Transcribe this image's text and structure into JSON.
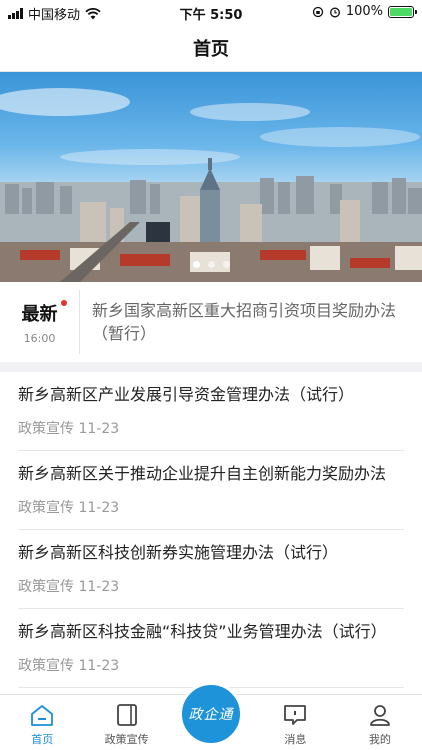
{
  "status_bar": {
    "carrier": "中国移动",
    "time": "下午 5:50",
    "battery": "100%"
  },
  "nav": {
    "title": "首页"
  },
  "latest": {
    "label": "最新",
    "time": "16:00",
    "text": "新乡国家高新区重大招商引资项目奖励办法（暂行）"
  },
  "news": [
    {
      "title": "新乡高新区产业发展引导资金管理办法（试行）",
      "meta": "政策宣传 11-23"
    },
    {
      "title": "新乡高新区关于推动企业提升自主创新能力奖励办法",
      "meta": "政策宣传 11-23"
    },
    {
      "title": "新乡高新区科技创新券实施管理办法（试行）",
      "meta": "政策宣传 11-23"
    },
    {
      "title": "新乡高新区科技金融“科技贷”业务管理办法（试行）",
      "meta": "政策宣传 11-23"
    }
  ],
  "tabs": {
    "home": "首页",
    "policy": "政策宣传",
    "center": "政企通",
    "messages": "消息",
    "mine": "我的"
  },
  "colors": {
    "accent": "#1b8fd9",
    "badge_dot": "#e5322d"
  }
}
